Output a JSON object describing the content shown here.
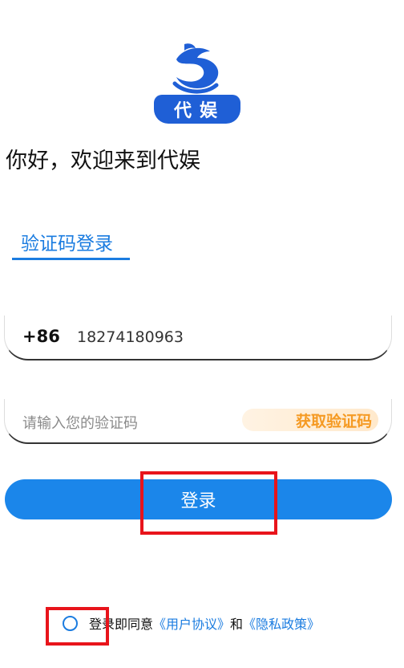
{
  "logo": {
    "badge_text": "代娱"
  },
  "greeting": "你好，欢迎来到代娱",
  "login_tab": {
    "label": "验证码登录"
  },
  "phone": {
    "country_code": "+86",
    "value": "18274180963"
  },
  "code": {
    "placeholder": "请输入您的验证码",
    "get_code_label": "获取验证码"
  },
  "login_button": {
    "label": "登录"
  },
  "agreement": {
    "prefix": "登录即同意",
    "user_agreement": "《用户协议》",
    "and": "和",
    "privacy_policy": "《隐私政策》"
  },
  "colors": {
    "primary": "#1b86ea",
    "link": "#1b7ce0",
    "get_code": "#f59a23",
    "highlight": "#e8141b"
  }
}
